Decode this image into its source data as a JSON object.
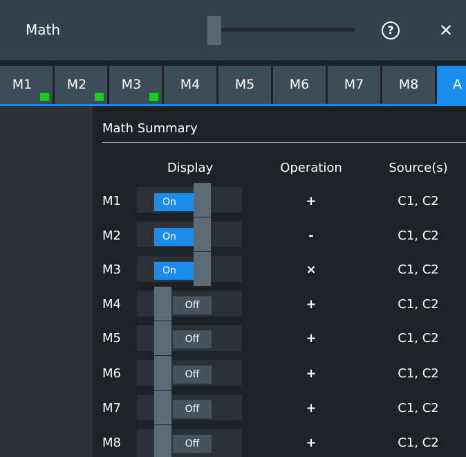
{
  "title": "Math",
  "help_label": "?",
  "close_label": "✕",
  "tabs": [
    {
      "label": "M1",
      "indicator": true
    },
    {
      "label": "M2",
      "indicator": true
    },
    {
      "label": "M3",
      "indicator": true
    },
    {
      "label": "M4",
      "indicator": false
    },
    {
      "label": "M5",
      "indicator": false
    },
    {
      "label": "M6",
      "indicator": false
    },
    {
      "label": "M7",
      "indicator": false
    },
    {
      "label": "M8",
      "indicator": false
    },
    {
      "label": "A",
      "indicator": false,
      "active": true
    }
  ],
  "colors": {
    "accent": "#1a8cf0",
    "indicator": "#17d117"
  },
  "summary": {
    "title": "Math Summary",
    "headers": {
      "display": "Display",
      "operation": "Operation",
      "sources": "Source(s)"
    },
    "rows": [
      {
        "name": "M1",
        "state": "on",
        "on_label": "On",
        "operation": "+",
        "sources": "C1, C2"
      },
      {
        "name": "M2",
        "state": "on",
        "on_label": "On",
        "operation": "-",
        "sources": "C1, C2"
      },
      {
        "name": "M3",
        "state": "on",
        "on_label": "On",
        "operation": "×",
        "sources": "C1, C2"
      },
      {
        "name": "M4",
        "state": "off",
        "off_label": "Off",
        "operation": "+",
        "sources": "C1, C2"
      },
      {
        "name": "M5",
        "state": "off",
        "off_label": "Off",
        "operation": "+",
        "sources": "C1, C2"
      },
      {
        "name": "M6",
        "state": "off",
        "off_label": "Off",
        "operation": "+",
        "sources": "C1, C2"
      },
      {
        "name": "M7",
        "state": "off",
        "off_label": "Off",
        "operation": "+",
        "sources": "C1, C2"
      },
      {
        "name": "M8",
        "state": "off",
        "off_label": "Off",
        "operation": "+",
        "sources": "C1, C2"
      }
    ]
  }
}
